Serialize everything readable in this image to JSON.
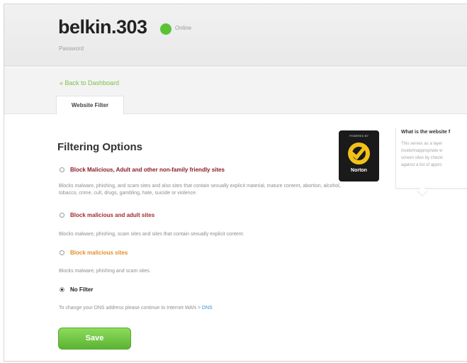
{
  "header": {
    "router_name": "belkin.303",
    "status_text": "Online",
    "password_label": "Password",
    "status_color": "#5bc236"
  },
  "nav": {
    "back_link": "« Back to Dashboard",
    "tab_label": "Website Filter"
  },
  "main": {
    "section_title": "Filtering Options",
    "options": [
      {
        "label": "Block Malicious, Adult and other non-family friendly sites",
        "description": "Blocks malware, phishing, and scam sites and also sites that contain sexually explicit material, mature content, abortion, alcohol, tobacco, crime, cult, drugs, gambling, hate, suicide or violence.",
        "color": "#8a1e2a",
        "selected": false
      },
      {
        "label": "Block malicious and adult sites",
        "description": "Blocks malware, phishing, scam sites and sites that contain sexually explicit content.",
        "color": "#a52a2a",
        "selected": false
      },
      {
        "label": "Block malicious sites",
        "description": "Blocks malware, phishing and scam sites.",
        "color": "#e0902a",
        "selected": false
      },
      {
        "label": "No Filter",
        "color": "#222222",
        "selected": true
      }
    ],
    "dns_note": "To change your DNS address please continue to Internet WAN >",
    "dns_link": "DNS",
    "save_label": "Save",
    "save_color": "#5bb332"
  },
  "norton": {
    "top_text": "POWERED BY",
    "label": "Norton",
    "icon": "norton-check-icon"
  },
  "info_panel": {
    "title": "What is the website f",
    "lines": [
      "This serves as a layer",
      "inside/inappropriate w",
      "screen sites by checki",
      "against a list of appro"
    ]
  }
}
